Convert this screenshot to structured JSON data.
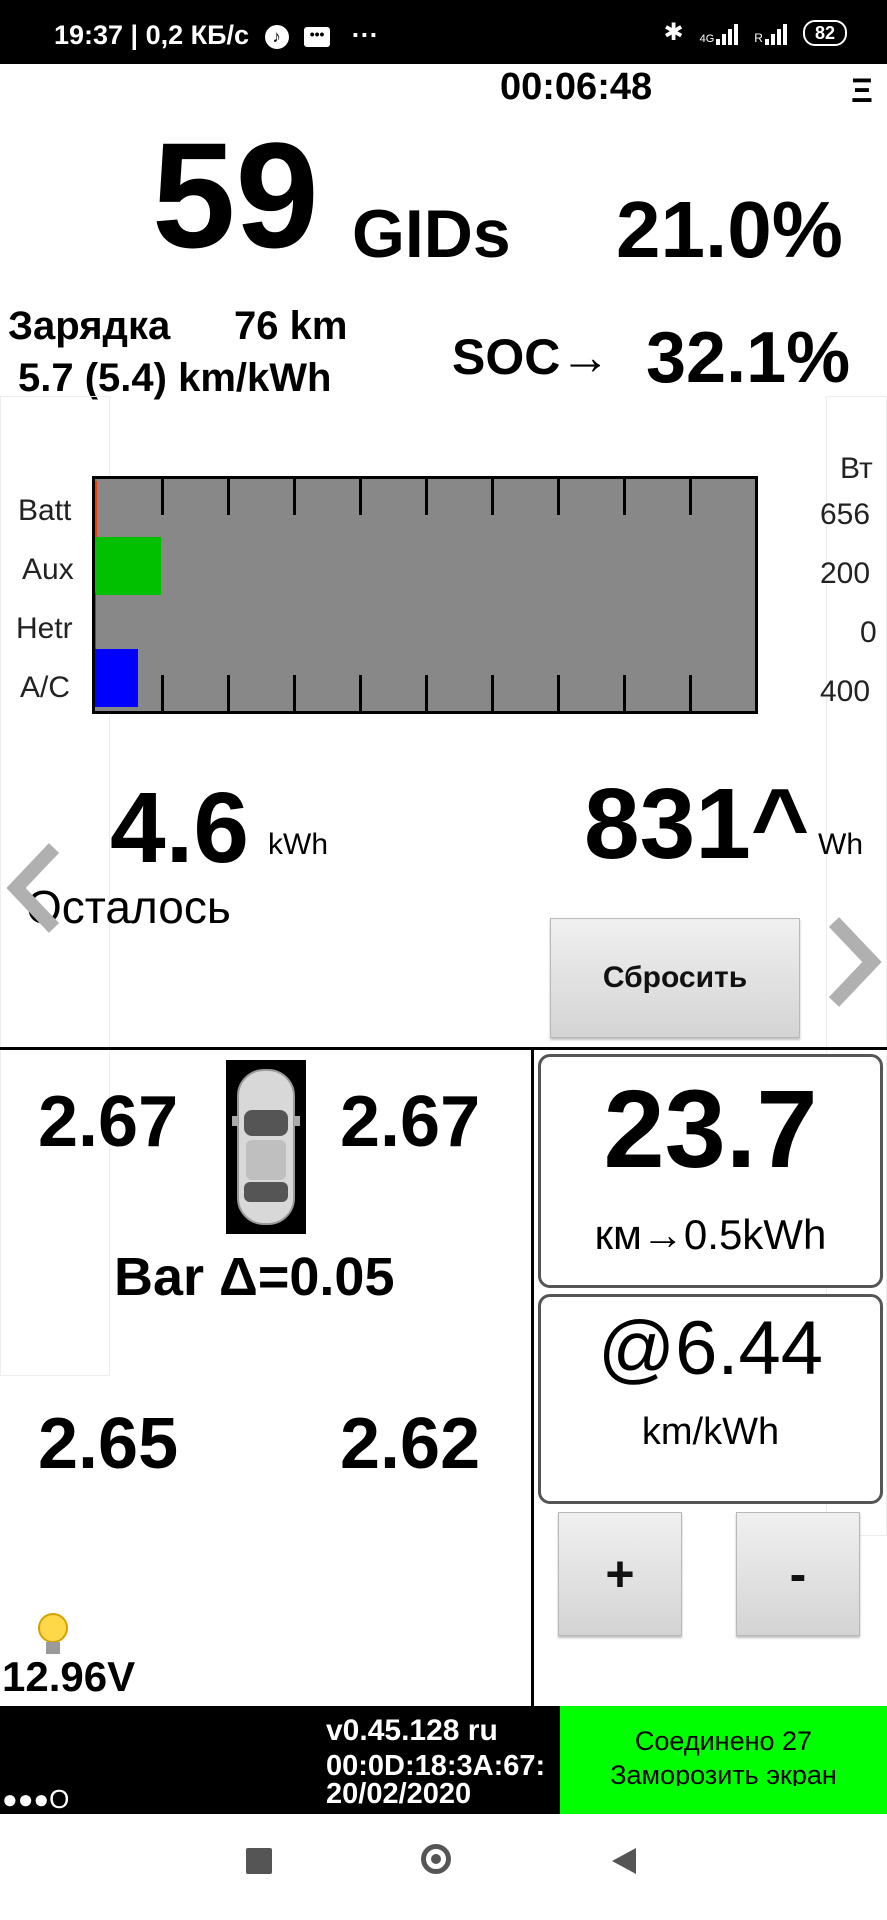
{
  "status_bar": {
    "time_speed": "19:37 | 0,2 КБ/с",
    "dots": "···",
    "net_4g": "4G",
    "net_r": "R",
    "battery": "82"
  },
  "timer": "00:06:48",
  "menu_glyph": "Ξ",
  "gids": {
    "value": "59",
    "unit": "GIDs",
    "percent": "21.0%"
  },
  "charging": {
    "label": "Зарядка",
    "range": "76 km",
    "efficiency": "5.7 (5.4) km/kWh",
    "soc_label": "SOC→",
    "soc_value": "32.1%"
  },
  "power_chart": {
    "unit_label": "Вт",
    "rows": [
      {
        "name": "Batt",
        "watts": "656",
        "fraction": 0.003,
        "color": "#ff3300"
      },
      {
        "name": "Aux",
        "watts": "200",
        "fraction": 0.1,
        "color": "#00c000"
      },
      {
        "name": "Hetr",
        "watts": "0",
        "fraction": 0.0,
        "color": "#cc00cc"
      },
      {
        "name": "A/C",
        "watts": "400",
        "fraction": 0.065,
        "color": "#0000ff"
      }
    ]
  },
  "energy": {
    "remaining_value": "4.6",
    "remaining_unit": "kWh",
    "remaining_label": "Осталось",
    "used_value": "831^",
    "used_unit": "Wh",
    "reset_button": "Сбросить"
  },
  "tires": {
    "front_left": "2.67",
    "front_right": "2.67",
    "unit_delta": "Bar  Δ=0.05",
    "rear_left": "2.65",
    "rear_right": "2.62"
  },
  "voltage": "12.96V",
  "range_panel": {
    "value": "23.7",
    "label": "км→0.5kWh"
  },
  "eff_panel": {
    "value": "@6.44",
    "label": "km/kWh"
  },
  "plus_button": "+",
  "minus_button": "-",
  "info": {
    "version": "v0.45.128 ru",
    "mac": "00:0D:18:3A:67:",
    "date": "20/02/2020",
    "dots": "●●●O",
    "connected": "Соединено 27",
    "freeze": "Заморозить экран"
  }
}
